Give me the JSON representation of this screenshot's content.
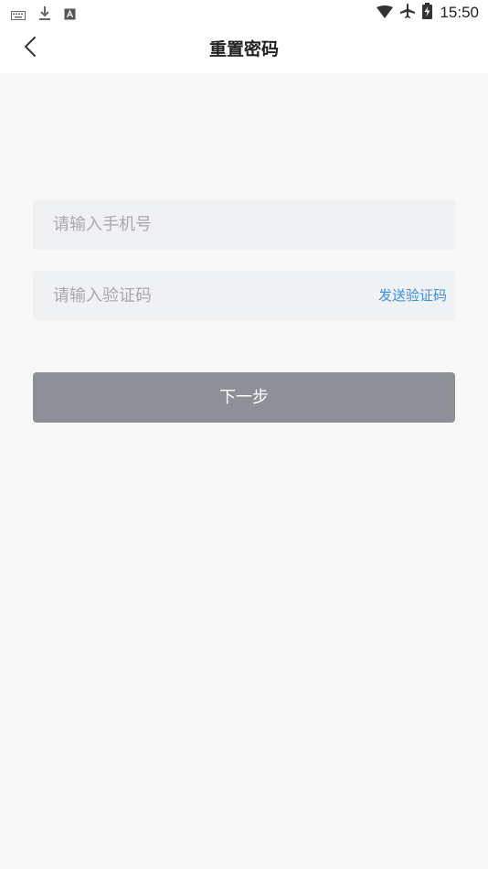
{
  "status_bar": {
    "time": "15:50",
    "left_icons": [
      "keyboard-icon",
      "download-icon",
      "a-icon"
    ],
    "right_icons": [
      "wifi-icon",
      "airplane-icon",
      "battery-charging-icon"
    ]
  },
  "nav": {
    "title": "重置密码",
    "back_icon": "chevron-left-icon"
  },
  "form": {
    "phone": {
      "placeholder": "请输入手机号",
      "value": ""
    },
    "code": {
      "placeholder": "请输入验证码",
      "value": ""
    },
    "send_code_label": "发送验证码",
    "next_label": "下一步"
  },
  "colors": {
    "background": "#f8f8f8",
    "field_bg": "#f0f1f3",
    "link": "#3a8fe8",
    "button_disabled": "#8d9097"
  }
}
